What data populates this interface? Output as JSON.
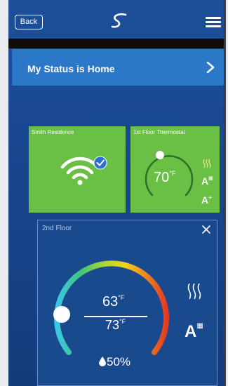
{
  "header": {
    "back_label": "Back",
    "logo_icon": "swirl-logo-icon",
    "menu_icon": "hamburger-menu-icon"
  },
  "status": {
    "text": "My Status is Home",
    "chevron_icon": "chevron-right-icon"
  },
  "tiles": [
    {
      "label": "Smith Residence",
      "icon": "wifi-connected-icon",
      "color": "#6abf45"
    },
    {
      "label": "1st Floor Thermostat",
      "temperature": "70",
      "unit": "°F",
      "color": "#6abf45"
    }
  ],
  "zone": {
    "label": "2nd Floor",
    "setpoint": "63",
    "setpoint_unit": "°F",
    "current": "73",
    "current_unit": "°F",
    "humidity": "50%",
    "heat_icon": "heat-waves-icon",
    "schedule_icon": "auto-schedule-icon",
    "close_icon": "close-icon"
  },
  "colors": {
    "background": "#1c4f9a",
    "status_bar": "#2a78c7",
    "tile_green": "#6abf45"
  }
}
